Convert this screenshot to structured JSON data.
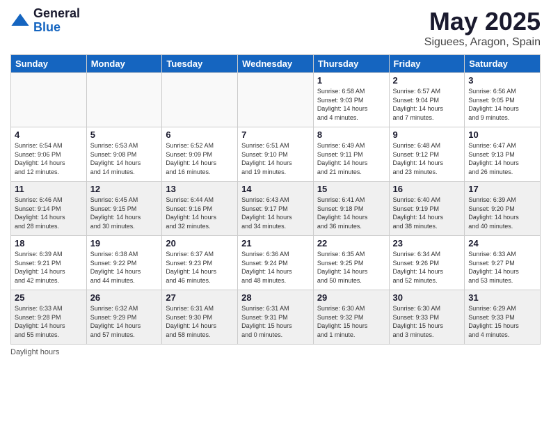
{
  "logo": {
    "general": "General",
    "blue": "Blue"
  },
  "header": {
    "month_year": "May 2025",
    "location": "Siguees, Aragon, Spain"
  },
  "days_of_week": [
    "Sunday",
    "Monday",
    "Tuesday",
    "Wednesday",
    "Thursday",
    "Friday",
    "Saturday"
  ],
  "footer": {
    "note": "Daylight hours"
  },
  "weeks": [
    [
      {
        "day": "",
        "info": ""
      },
      {
        "day": "",
        "info": ""
      },
      {
        "day": "",
        "info": ""
      },
      {
        "day": "",
        "info": ""
      },
      {
        "day": "1",
        "info": "Sunrise: 6:58 AM\nSunset: 9:03 PM\nDaylight: 14 hours\nand 4 minutes."
      },
      {
        "day": "2",
        "info": "Sunrise: 6:57 AM\nSunset: 9:04 PM\nDaylight: 14 hours\nand 7 minutes."
      },
      {
        "day": "3",
        "info": "Sunrise: 6:56 AM\nSunset: 9:05 PM\nDaylight: 14 hours\nand 9 minutes."
      }
    ],
    [
      {
        "day": "4",
        "info": "Sunrise: 6:54 AM\nSunset: 9:06 PM\nDaylight: 14 hours\nand 12 minutes."
      },
      {
        "day": "5",
        "info": "Sunrise: 6:53 AM\nSunset: 9:08 PM\nDaylight: 14 hours\nand 14 minutes."
      },
      {
        "day": "6",
        "info": "Sunrise: 6:52 AM\nSunset: 9:09 PM\nDaylight: 14 hours\nand 16 minutes."
      },
      {
        "day": "7",
        "info": "Sunrise: 6:51 AM\nSunset: 9:10 PM\nDaylight: 14 hours\nand 19 minutes."
      },
      {
        "day": "8",
        "info": "Sunrise: 6:49 AM\nSunset: 9:11 PM\nDaylight: 14 hours\nand 21 minutes."
      },
      {
        "day": "9",
        "info": "Sunrise: 6:48 AM\nSunset: 9:12 PM\nDaylight: 14 hours\nand 23 minutes."
      },
      {
        "day": "10",
        "info": "Sunrise: 6:47 AM\nSunset: 9:13 PM\nDaylight: 14 hours\nand 26 minutes."
      }
    ],
    [
      {
        "day": "11",
        "info": "Sunrise: 6:46 AM\nSunset: 9:14 PM\nDaylight: 14 hours\nand 28 minutes."
      },
      {
        "day": "12",
        "info": "Sunrise: 6:45 AM\nSunset: 9:15 PM\nDaylight: 14 hours\nand 30 minutes."
      },
      {
        "day": "13",
        "info": "Sunrise: 6:44 AM\nSunset: 9:16 PM\nDaylight: 14 hours\nand 32 minutes."
      },
      {
        "day": "14",
        "info": "Sunrise: 6:43 AM\nSunset: 9:17 PM\nDaylight: 14 hours\nand 34 minutes."
      },
      {
        "day": "15",
        "info": "Sunrise: 6:41 AM\nSunset: 9:18 PM\nDaylight: 14 hours\nand 36 minutes."
      },
      {
        "day": "16",
        "info": "Sunrise: 6:40 AM\nSunset: 9:19 PM\nDaylight: 14 hours\nand 38 minutes."
      },
      {
        "day": "17",
        "info": "Sunrise: 6:39 AM\nSunset: 9:20 PM\nDaylight: 14 hours\nand 40 minutes."
      }
    ],
    [
      {
        "day": "18",
        "info": "Sunrise: 6:39 AM\nSunset: 9:21 PM\nDaylight: 14 hours\nand 42 minutes."
      },
      {
        "day": "19",
        "info": "Sunrise: 6:38 AM\nSunset: 9:22 PM\nDaylight: 14 hours\nand 44 minutes."
      },
      {
        "day": "20",
        "info": "Sunrise: 6:37 AM\nSunset: 9:23 PM\nDaylight: 14 hours\nand 46 minutes."
      },
      {
        "day": "21",
        "info": "Sunrise: 6:36 AM\nSunset: 9:24 PM\nDaylight: 14 hours\nand 48 minutes."
      },
      {
        "day": "22",
        "info": "Sunrise: 6:35 AM\nSunset: 9:25 PM\nDaylight: 14 hours\nand 50 minutes."
      },
      {
        "day": "23",
        "info": "Sunrise: 6:34 AM\nSunset: 9:26 PM\nDaylight: 14 hours\nand 52 minutes."
      },
      {
        "day": "24",
        "info": "Sunrise: 6:33 AM\nSunset: 9:27 PM\nDaylight: 14 hours\nand 53 minutes."
      }
    ],
    [
      {
        "day": "25",
        "info": "Sunrise: 6:33 AM\nSunset: 9:28 PM\nDaylight: 14 hours\nand 55 minutes."
      },
      {
        "day": "26",
        "info": "Sunrise: 6:32 AM\nSunset: 9:29 PM\nDaylight: 14 hours\nand 57 minutes."
      },
      {
        "day": "27",
        "info": "Sunrise: 6:31 AM\nSunset: 9:30 PM\nDaylight: 14 hours\nand 58 minutes."
      },
      {
        "day": "28",
        "info": "Sunrise: 6:31 AM\nSunset: 9:31 PM\nDaylight: 15 hours\nand 0 minutes."
      },
      {
        "day": "29",
        "info": "Sunrise: 6:30 AM\nSunset: 9:32 PM\nDaylight: 15 hours\nand 1 minute."
      },
      {
        "day": "30",
        "info": "Sunrise: 6:30 AM\nSunset: 9:33 PM\nDaylight: 15 hours\nand 3 minutes."
      },
      {
        "day": "31",
        "info": "Sunrise: 6:29 AM\nSunset: 9:33 PM\nDaylight: 15 hours\nand 4 minutes."
      }
    ]
  ]
}
